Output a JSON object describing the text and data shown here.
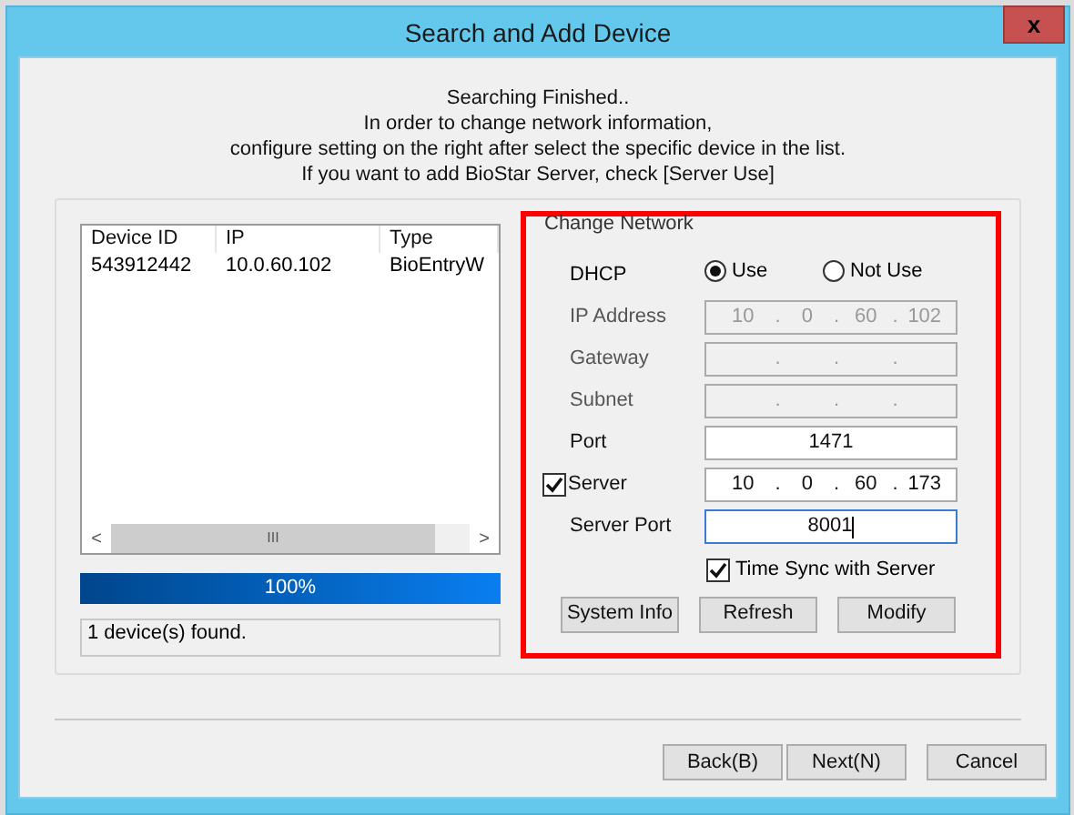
{
  "window": {
    "title": "Search and Add Device",
    "close": "x"
  },
  "message": [
    "Searching Finished..",
    "In order to change network information,",
    "configure setting on the right after select the specific device in the list.",
    "If you want to add BioStar Server, check [Server Use]"
  ],
  "device_list": {
    "columns": [
      "Device ID",
      "IP",
      "Type"
    ],
    "rows": [
      {
        "cells": [
          "543912442",
          "10.0.60.102",
          "BioEntryW"
        ],
        "selected": false
      }
    ],
    "scrollbar": {
      "left": "<",
      "thumb": "III",
      "right": ">"
    }
  },
  "progress": {
    "level": 1,
    "reading": "100%"
  },
  "status": "1 device(s) found.",
  "change_network": {
    "title": "Change Network",
    "dhcp": {
      "label": "DHCP",
      "options": [
        {
          "label": "Use",
          "selected": true
        },
        {
          "label": "Not Use",
          "selected": false
        }
      ]
    },
    "fields": [
      {
        "label": "IP Address",
        "kind": "ip",
        "octets": [
          "10",
          "0",
          "60",
          "102"
        ],
        "separator": ".",
        "disabled": true,
        "focused": false
      },
      {
        "label": "Gateway",
        "kind": "ip",
        "separator": ".",
        "disabled": true,
        "focused": false
      },
      {
        "label": "Subnet",
        "kind": "ip",
        "separator": ".",
        "disabled": true,
        "focused": false
      },
      {
        "label": "Port",
        "kind": "text",
        "value": "1471",
        "disabled": false,
        "focused": false
      },
      {
        "label": "Server",
        "kind": "ip",
        "octets": [
          "10",
          "0",
          "60",
          "173"
        ],
        "separator": ".",
        "disabled": false,
        "focused": false,
        "checkbox": {
          "checked": true
        }
      },
      {
        "label": "Server Port",
        "kind": "text",
        "value": "8001",
        "disabled": false,
        "focused": true
      }
    ],
    "time_sync": {
      "label": "Time Sync with Server",
      "checked": true
    },
    "buttons": [
      "System Info",
      "Refresh",
      "Modify"
    ]
  },
  "buttons": [
    "Back(B)",
    "Next(N)",
    "Cancel"
  ]
}
